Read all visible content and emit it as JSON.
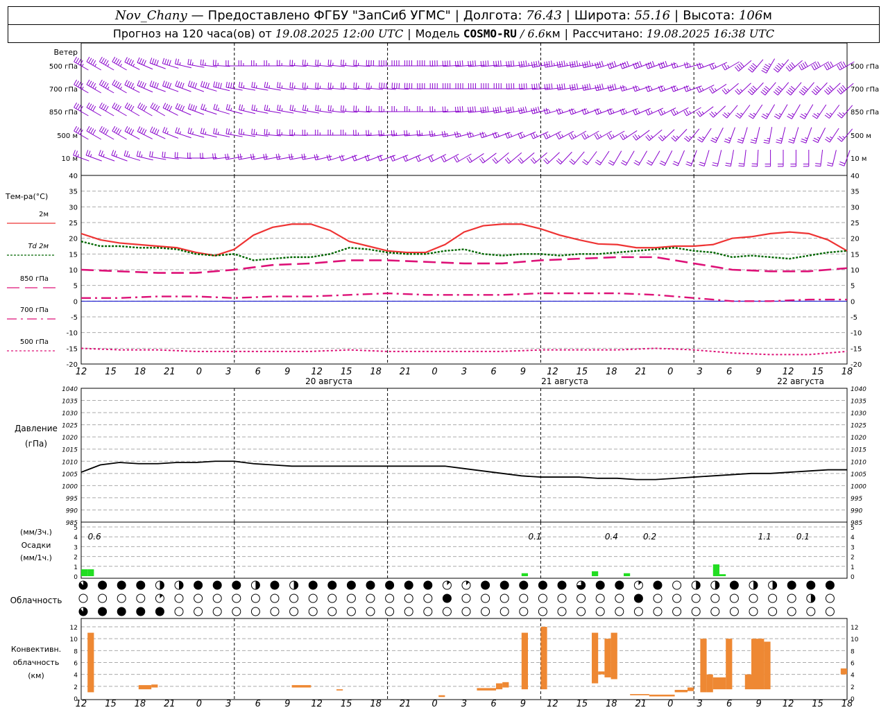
{
  "header": {
    "station": "Nov_Chany",
    "dash": "—",
    "provider": "Предоставлено ФГБУ \"ЗапСиб УГМС\"",
    "lon_label": "Долгота:",
    "lon_value": "76.43",
    "lat_label": "Широта:",
    "lat_value": "55.16",
    "alt_label": "Высота:",
    "alt_value": "106",
    "alt_unit": "м",
    "forecast_prefix": "Прогноз на 120 часа(ов) от",
    "forecast_start": "19.08.2025 12:00 UTC",
    "model_label": "Модель",
    "model_name": "COSMO-RU",
    "model_res_value": "/ 6.6",
    "model_res_unit": "км",
    "calc_label": "Рассчитано:",
    "calc_time": "19.08.2025 16:38 UTC"
  },
  "colors": {
    "wind": "#8800cc",
    "t2m": "#ee3333",
    "td2m": "#006600",
    "t850": "#dd1177",
    "t700": "#dd1177",
    "t500": "#dd1177",
    "zero_line": "#0000cc",
    "precip": "#22dd22",
    "conv": "#ee8833",
    "grid": "#aaaaaa"
  },
  "time_axis": {
    "hour_labels": [
      "12",
      "15",
      "18",
      "21",
      "0",
      "3",
      "6",
      "9",
      "12",
      "15",
      "18",
      "21",
      "0",
      "3",
      "6",
      "9",
      "12",
      "15",
      "18",
      "21",
      "0",
      "3",
      "6",
      "9",
      "12",
      "15",
      "18"
    ],
    "date_labels": [
      "20 августа",
      "21 августа",
      "22 августа"
    ]
  },
  "wind_panel": {
    "title": "Ветер",
    "levels": [
      "500 гПа",
      "700 гПа",
      "850 гПа",
      "500 м",
      "10  м"
    ]
  },
  "temp_panel": {
    "title": "Тем-ра(°С)",
    "legend": [
      {
        "label": "2м",
        "style": "solid"
      },
      {
        "label": "Td  2м",
        "style": "dotted"
      },
      {
        "label": "850 гПа",
        "style": "dash"
      },
      {
        "label": "700 гПа",
        "style": "dashdot"
      },
      {
        "label": "500 гПа",
        "style": "dense"
      }
    ],
    "ticks": [
      "40",
      "35",
      "30",
      "25",
      "20",
      "15",
      "10",
      "5",
      "0",
      "-5",
      "-10",
      "-15",
      "-20"
    ]
  },
  "pressure_panel": {
    "title1": "Давление",
    "title2": "(гПа)",
    "ticks": [
      "1040",
      "1035",
      "1030",
      "1025",
      "1020",
      "1015",
      "1010",
      "1005",
      "1000",
      "995",
      "990",
      "985"
    ]
  },
  "precip_panel": {
    "title1": "(мм/3ч.)",
    "title2": "Осадки",
    "title3": "(мм/1ч.)",
    "ticks": [
      "5",
      "4",
      "3",
      "2",
      "1",
      "0"
    ],
    "totals": [
      {
        "h": 1,
        "text": "0.6"
      },
      {
        "h": 70,
        "text": "0.1"
      },
      {
        "h": 82,
        "text": "0.4"
      },
      {
        "h": 88,
        "text": "0.2"
      },
      {
        "h": 106,
        "text": "1.1"
      },
      {
        "h": 112,
        "text": "0.1"
      }
    ]
  },
  "cloud_panel": {
    "title": "Облачность",
    "rows": [
      "7888488888484884878888888484888464888188888848888888118881141888888888888888886888888711088100164844188814484888888888888",
      "0000000080001100100000000000000010000000000000000000000008080000000000000000000000000008000800060000000000000000084000800",
      "7888888888858000000000000000000000000000000000000000000000000000000000000000000000000000000000000000000000000800000000000"
    ]
  },
  "conv_panel": {
    "title1": "Конвективн.",
    "title2": "облачность",
    "title3": "(км)",
    "ticks": [
      "12",
      "10",
      "8",
      "6",
      "4",
      "2",
      "0"
    ]
  },
  "chart_data": [
    {
      "type": "wind_barbs",
      "title": "Ветер",
      "x_unit": "hours from 19.08.2025 12:00 UTC",
      "levels": [
        "500 гПа",
        "700 гПа",
        "850 гПа",
        "500 м",
        "10  м"
      ],
      "x": [
        0,
        6,
        12,
        18,
        24,
        30,
        36,
        42,
        48,
        54,
        60,
        66,
        72,
        78,
        84,
        90,
        96,
        102,
        108,
        114,
        120
      ],
      "direction_deg": [
        [
          300,
          300,
          290,
          280,
          270,
          270,
          275,
          275,
          270,
          270,
          265,
          265,
          260,
          260,
          250,
          250,
          255,
          240,
          210,
          240,
          240
        ],
        [
          300,
          300,
          290,
          290,
          280,
          280,
          275,
          275,
          275,
          270,
          270,
          270,
          265,
          260,
          255,
          250,
          250,
          230,
          220,
          220,
          230
        ],
        [
          300,
          300,
          300,
          290,
          285,
          280,
          280,
          275,
          270,
          270,
          265,
          260,
          255,
          250,
          250,
          245,
          240,
          220,
          210,
          210,
          220
        ],
        [
          300,
          300,
          295,
          285,
          280,
          275,
          270,
          270,
          265,
          265,
          255,
          250,
          245,
          240,
          240,
          230,
          220,
          200,
          190,
          200,
          220
        ],
        [
          290,
          290,
          280,
          270,
          260,
          260,
          260,
          250,
          250,
          245,
          240,
          230,
          230,
          220,
          210,
          210,
          200,
          190,
          180,
          180,
          200
        ]
      ],
      "speed_ms": [
        [
          12,
          12,
          10,
          8,
          6,
          8,
          8,
          8,
          10,
          10,
          10,
          10,
          12,
          12,
          10,
          10,
          8,
          8,
          12,
          10,
          10
        ],
        [
          12,
          12,
          10,
          10,
          9,
          8,
          8,
          8,
          9,
          9,
          10,
          10,
          10,
          10,
          9,
          8,
          8,
          8,
          10,
          10,
          10
        ],
        [
          10,
          10,
          10,
          9,
          8,
          8,
          7,
          8,
          8,
          8,
          9,
          9,
          9,
          8,
          8,
          8,
          7,
          8,
          8,
          8,
          8
        ],
        [
          10,
          9,
          9,
          8,
          8,
          7,
          7,
          7,
          8,
          8,
          8,
          8,
          8,
          8,
          7,
          7,
          7,
          8,
          8,
          8,
          8
        ],
        [
          7,
          7,
          6,
          6,
          5,
          5,
          5,
          5,
          6,
          6,
          6,
          6,
          6,
          6,
          5,
          5,
          5,
          5,
          5,
          5,
          5
        ]
      ]
    },
    {
      "type": "line",
      "title": "Тем-ра(°С)",
      "ylim": [
        -20,
        40
      ],
      "x_unit": "hours from 19.08.2025 12:00 UTC",
      "series": [
        {
          "name": "2м",
          "x": [
            0,
            3,
            6,
            9,
            12,
            15,
            18,
            21,
            24,
            27,
            30,
            33,
            36,
            39,
            42,
            45,
            48,
            51,
            54,
            57,
            60,
            63,
            66,
            69,
            72,
            75,
            78,
            81,
            84,
            87,
            90,
            93,
            96,
            99,
            102,
            105,
            108,
            111,
            114,
            117,
            120
          ],
          "values": [
            21.5,
            19.5,
            18.5,
            18,
            17.5,
            17,
            15.5,
            14.5,
            16.5,
            21,
            23.5,
            24.5,
            24.5,
            22.5,
            19,
            17.5,
            16,
            15.5,
            15.5,
            18,
            22,
            24,
            24.5,
            24.5,
            23,
            21,
            19.5,
            18.2,
            18,
            17,
            17,
            17.5,
            17.5,
            18,
            20,
            20.5,
            21.5,
            22,
            21.5,
            19.5,
            16
          ]
        },
        {
          "name": "Td  2м",
          "x": [
            0,
            3,
            6,
            9,
            12,
            15,
            18,
            21,
            24,
            27,
            30,
            33,
            36,
            39,
            42,
            45,
            48,
            51,
            54,
            57,
            60,
            63,
            66,
            69,
            72,
            75,
            78,
            81,
            84,
            87,
            90,
            93,
            96,
            99,
            102,
            105,
            108,
            111,
            114,
            117,
            120
          ],
          "values": [
            19,
            17.5,
            17.5,
            17,
            17,
            16.5,
            15,
            14.5,
            15,
            13,
            13.5,
            14,
            14,
            15,
            17,
            16.5,
            15.5,
            15,
            15,
            16,
            16.5,
            15,
            14.5,
            15,
            15,
            14.5,
            15,
            15,
            15.5,
            16,
            16.5,
            17,
            16,
            15.5,
            14,
            14.5,
            14,
            13.5,
            14.5,
            15.5,
            16
          ]
        },
        {
          "name": "850 гПа",
          "x": [
            0,
            6,
            12,
            18,
            24,
            30,
            36,
            42,
            48,
            54,
            60,
            66,
            72,
            78,
            84,
            90,
            96,
            102,
            108,
            114,
            120
          ],
          "values": [
            10,
            9.5,
            9,
            9,
            10,
            11.5,
            12,
            13,
            13,
            12.5,
            12,
            12,
            13,
            13.5,
            14,
            14,
            12,
            10,
            9.5,
            9.5,
            10.5
          ]
        },
        {
          "name": "700 гПа",
          "x": [
            0,
            6,
            12,
            18,
            24,
            30,
            36,
            42,
            48,
            54,
            60,
            66,
            72,
            78,
            84,
            90,
            96,
            102,
            108,
            114,
            120
          ],
          "values": [
            1,
            1,
            1.5,
            1.5,
            1,
            1.5,
            1.5,
            2,
            2.5,
            2,
            2,
            2,
            2.5,
            2.5,
            2.5,
            2,
            1,
            0,
            0,
            0.5,
            0.5
          ]
        },
        {
          "name": "500 гПа",
          "x": [
            0,
            6,
            12,
            18,
            24,
            30,
            36,
            42,
            48,
            54,
            60,
            66,
            72,
            78,
            84,
            90,
            96,
            102,
            108,
            114,
            120
          ],
          "values": [
            -15,
            -15.5,
            -15.5,
            -16,
            -16,
            -16,
            -16,
            -15.5,
            -16,
            -16,
            -16,
            -16,
            -15.5,
            -15.5,
            -15.5,
            -15,
            -15.5,
            -16.5,
            -17,
            -17,
            -16
          ]
        }
      ]
    },
    {
      "type": "line",
      "title": "Давление (гПа)",
      "ylim": [
        985,
        1040
      ],
      "x_unit": "hours from 19.08.2025 12:00 UTC",
      "x": [
        0,
        3,
        6,
        9,
        12,
        15,
        18,
        21,
        24,
        27,
        30,
        33,
        36,
        39,
        42,
        45,
        48,
        51,
        54,
        57,
        60,
        63,
        66,
        69,
        72,
        75,
        78,
        81,
        84,
        87,
        90,
        93,
        96,
        99,
        102,
        105,
        108,
        111,
        114,
        117,
        120
      ],
      "values": [
        1005.5,
        1008.5,
        1009.5,
        1009,
        1009,
        1009.5,
        1009.5,
        1010,
        1010,
        1009,
        1008.5,
        1008,
        1008,
        1008,
        1008,
        1008,
        1008,
        1008,
        1008,
        1008,
        1007,
        1006,
        1005,
        1004,
        1003.5,
        1003.5,
        1003.5,
        1003,
        1003,
        1002.5,
        1002.5,
        1003,
        1003.5,
        1004,
        1004.5,
        1005,
        1005,
        1005.5,
        1006,
        1006.5,
        1006.5
      ]
    },
    {
      "type": "bar",
      "title": "Осадки (мм/1ч.)",
      "ylim": [
        0,
        5
      ],
      "x_unit": "hours from 19.08.2025 12:00 UTC",
      "x": [
        0,
        1,
        69,
        80,
        85,
        99,
        100
      ],
      "values": [
        0.7,
        0.7,
        0.3,
        0.5,
        0.3,
        1.2,
        0.2
      ]
    },
    {
      "type": "bar",
      "title": "Конвективн. облачность (км)",
      "ylim": [
        0,
        12
      ],
      "x_unit": "hours from 19.08.2025 12:00 UTC",
      "bars": [
        {
          "x0": 1,
          "x1": 2,
          "base": 1,
          "top": 11
        },
        {
          "x0": 9,
          "x1": 11,
          "base": 1.5,
          "top": 2.2
        },
        {
          "x0": 11,
          "x1": 12,
          "base": 1.8,
          "top": 2.3
        },
        {
          "x0": 33,
          "x1": 36,
          "base": 1.8,
          "top": 2.2
        },
        {
          "x0": 40,
          "x1": 41,
          "base": 1.3,
          "top": 1.5
        },
        {
          "x0": 56,
          "x1": 57,
          "base": 0.2,
          "top": 0.5
        },
        {
          "x0": 62,
          "x1": 65,
          "base": 1.3,
          "top": 1.7
        },
        {
          "x0": 65,
          "x1": 66,
          "base": 1.5,
          "top": 2.5
        },
        {
          "x0": 66,
          "x1": 67,
          "base": 1.8,
          "top": 2.7
        },
        {
          "x0": 69,
          "x1": 70,
          "base": 1.5,
          "top": 11
        },
        {
          "x0": 72,
          "x1": 73,
          "base": 1.5,
          "top": 12
        },
        {
          "x0": 80,
          "x1": 81,
          "base": 2.5,
          "top": 11
        },
        {
          "x0": 81,
          "x1": 82,
          "base": 4,
          "top": 4.5
        },
        {
          "x0": 82,
          "x1": 83,
          "base": 3.5,
          "top": 10
        },
        {
          "x0": 83,
          "x1": 84,
          "base": 3.2,
          "top": 11
        },
        {
          "x0": 86,
          "x1": 89,
          "base": 0.5,
          "top": 0.7
        },
        {
          "x0": 89,
          "x1": 93,
          "base": 0.3,
          "top": 0.6
        },
        {
          "x0": 93,
          "x1": 95,
          "base": 1,
          "top": 1.4
        },
        {
          "x0": 95,
          "x1": 96,
          "base": 1.2,
          "top": 1.8
        },
        {
          "x0": 97,
          "x1": 98,
          "base": 1,
          "top": 10
        },
        {
          "x0": 98,
          "x1": 99,
          "base": 1,
          "top": 4
        },
        {
          "x0": 99,
          "x1": 101,
          "base": 1.5,
          "top": 3.5
        },
        {
          "x0": 101,
          "x1": 102,
          "base": 1.5,
          "top": 10
        },
        {
          "x0": 104,
          "x1": 105,
          "base": 1.5,
          "top": 4
        },
        {
          "x0": 105,
          "x1": 107,
          "base": 1.5,
          "top": 10
        },
        {
          "x0": 107,
          "x1": 108,
          "base": 1.5,
          "top": 9.5
        },
        {
          "x0": 119,
          "x1": 120,
          "base": 4,
          "top": 5
        }
      ]
    }
  ]
}
